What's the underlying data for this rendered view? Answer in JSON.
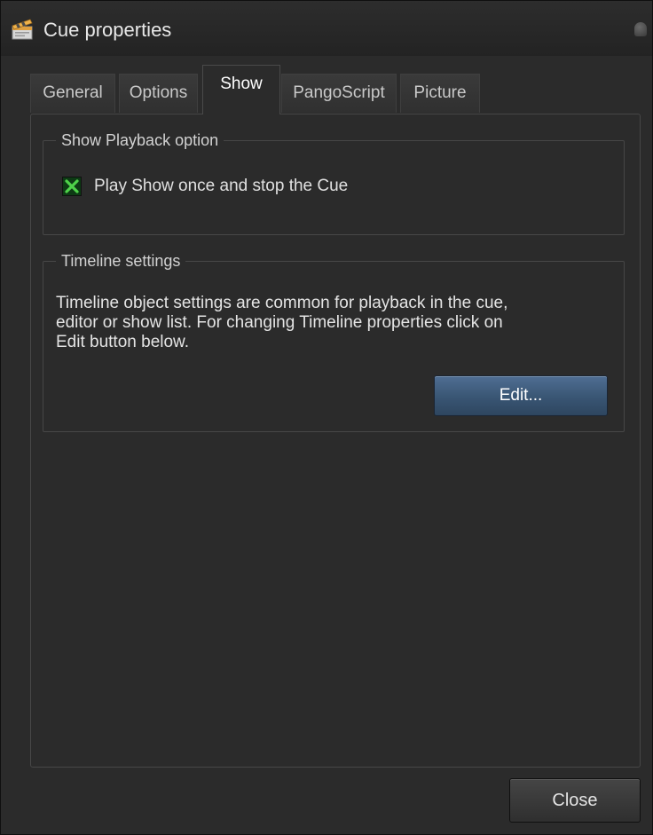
{
  "window": {
    "title": "Cue properties"
  },
  "tabs": [
    {
      "label": "General",
      "active": false
    },
    {
      "label": "Options",
      "active": false
    },
    {
      "label": "Show",
      "active": true
    },
    {
      "label": "PangoScript",
      "active": false
    },
    {
      "label": "Picture",
      "active": false
    }
  ],
  "show_playback": {
    "legend": "Show Playback option",
    "checkbox_label": "Play Show once and stop the Cue",
    "checked": true
  },
  "timeline": {
    "legend": "Timeline settings",
    "description_lines": [
      "Timeline object settings are common for playback in the cue,",
      "editor or show list. For changing Timeline properties click on",
      "Edit button below."
    ],
    "edit_label": "Edit..."
  },
  "footer": {
    "close_label": "Close"
  },
  "colors": {
    "background": "#2b2b2b",
    "accent_button": "#395573",
    "checkbox_mark": "#4fd24a"
  },
  "icons": {
    "title": "clapperboard-icon",
    "checkbox": "check-x-icon"
  }
}
